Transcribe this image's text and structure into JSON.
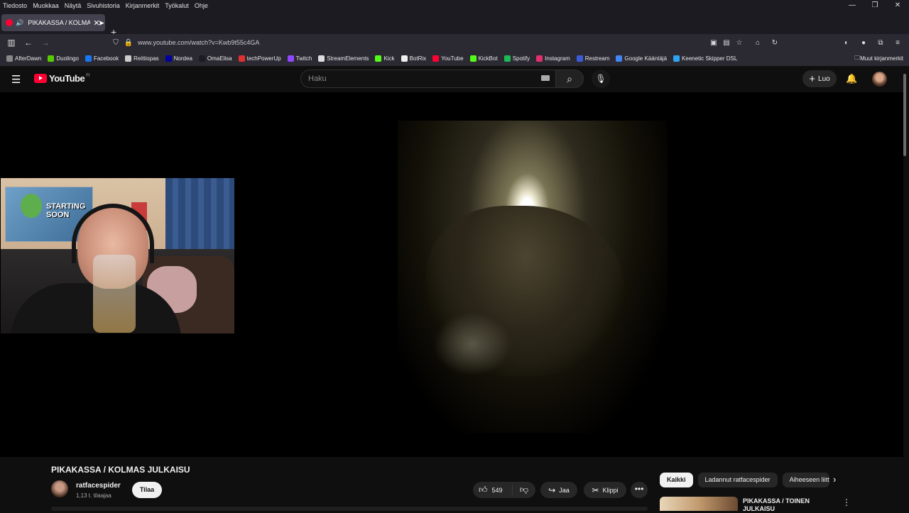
{
  "menubar": {
    "items": [
      "Tiedosto",
      "Muokkaa",
      "Näytä",
      "Sivuhistoria",
      "Kirjanmerkit",
      "Työkalut",
      "Ohje"
    ]
  },
  "tab": {
    "title": "PIKAKASSA / KOLMAS JUL",
    "favicon": "youtube-icon",
    "audio_icon": "speaker-icon"
  },
  "url": "www.youtube.com/watch?v=Kwb9t55c4GA",
  "bookmarks": [
    {
      "label": "AfterDawn",
      "color": "#888888"
    },
    {
      "label": "Duolingo",
      "color": "#58cc02"
    },
    {
      "label": "Facebook",
      "color": "#1877f2"
    },
    {
      "label": "Reittiopas",
      "color": "#cccccc"
    },
    {
      "label": "Nordea",
      "color": "#0000a0"
    },
    {
      "label": "OmaElisa",
      "color": "#1c1b22"
    },
    {
      "label": "techPowerUp",
      "color": "#e03030"
    },
    {
      "label": "Twitch",
      "color": "#9146ff"
    },
    {
      "label": "StreamElements",
      "color": "#dddddd"
    },
    {
      "label": "Kick",
      "color": "#53fc18"
    },
    {
      "label": "BotRix",
      "color": "#eeeeee"
    },
    {
      "label": "YouTube",
      "color": "#ff0033"
    },
    {
      "label": "KickBot",
      "color": "#53fc18"
    },
    {
      "label": "Spotify",
      "color": "#1db954"
    },
    {
      "label": "Instagram",
      "color": "#e1306c"
    },
    {
      "label": "Restream",
      "color": "#3b5bdb"
    },
    {
      "label": "Google Kääntäjä",
      "color": "#4285f4"
    },
    {
      "label": "Keenetic Skipper DSL",
      "color": "#2ea3f2"
    }
  ],
  "bookmarks_other": "Muut kirjanmerkit",
  "youtube": {
    "logo_text": "YouTube",
    "country_code": "FI",
    "search_placeholder": "Haku",
    "create_label": "Luo"
  },
  "video": {
    "title": "PIKAKASSA / KOLMAS JULKAISU",
    "channel": "ratfacespider",
    "subscribers": "1,13 t. tilaajaa",
    "subscribe_label": "Tilaa",
    "likes": "549",
    "share_label": "Jaa",
    "clip_label": "Klippi"
  },
  "webcam": {
    "poster_text": "STARTING SOON"
  },
  "chips": [
    "Kaikki",
    "Ladannut ratfacespider",
    "Aiheeseen liitty"
  ],
  "recommendation": {
    "title": "PIKAKASSA / TOINEN JULKAISU"
  },
  "colors": {
    "brand": "#ff0033",
    "background": "#0f0f0f",
    "chip": "#272727"
  }
}
